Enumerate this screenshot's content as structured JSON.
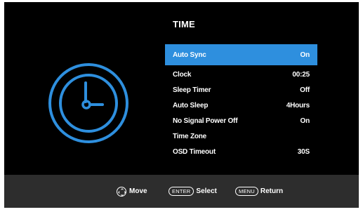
{
  "menu": {
    "title": "TIME",
    "items": [
      {
        "label": "Auto Sync",
        "value": "On",
        "selected": true
      },
      {
        "label": "Clock",
        "value": "00:25"
      },
      {
        "label": "Sleep Timer",
        "value": "Off"
      },
      {
        "label": "Auto Sleep",
        "value": "4Hours"
      },
      {
        "label": "No Signal Power Off",
        "value": "On"
      },
      {
        "label": "Time Zone",
        "value": ""
      },
      {
        "label": "OSD Timeout",
        "value": "30S"
      }
    ]
  },
  "footer": {
    "move": {
      "icon": "dpad-icon",
      "label": "Move"
    },
    "select": {
      "key": "ENTER",
      "label": "Select"
    },
    "return": {
      "key": "MENU",
      "label": "Return"
    }
  },
  "colors": {
    "accent": "#2e8fde",
    "background": "#000000",
    "footer": "#2d2d2d",
    "clock": "#2e8fde"
  }
}
